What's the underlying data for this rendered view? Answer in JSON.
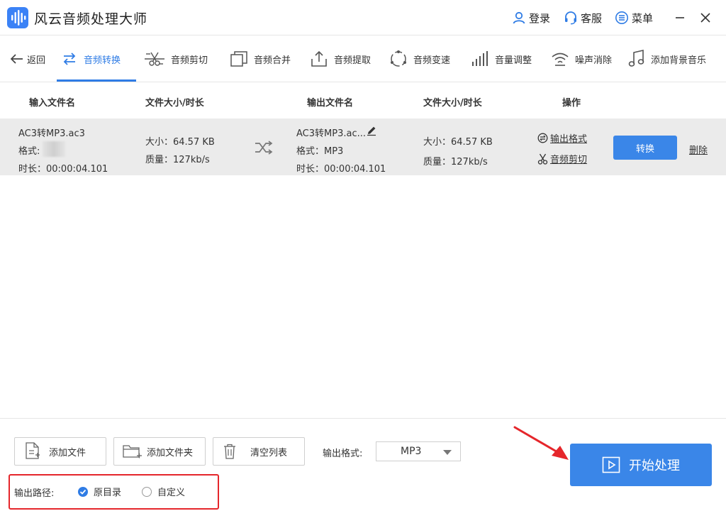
{
  "app": {
    "title": "风云音频处理大师",
    "login": "登录",
    "service": "客服",
    "menu": "菜单"
  },
  "nav": {
    "back": "返回",
    "tabs": [
      "音频转换",
      "音频剪切",
      "音频合并",
      "音频提取",
      "音频变速",
      "音量调整",
      "噪声消除",
      "添加背景音乐"
    ],
    "active_index": 0
  },
  "table": {
    "headers": [
      "输入文件名",
      "文件大小/时长",
      "输出文件名",
      "文件大小/时长",
      "操作"
    ],
    "row": {
      "input_name": "AC3转MP3.ac3",
      "input_format_label": "格式:",
      "input_duration": "时长：00:00:04.101",
      "input_size": "大小：64.57 KB",
      "input_quality": "质量：127kb/s",
      "output_name": "AC3转MP3.ac...",
      "output_format": "格式：MP3",
      "output_duration": "时长：00:00:04.101",
      "output_size": "大小：64.57 KB",
      "output_quality": "质量：127kb/s",
      "op_output_format": "输出格式",
      "op_audio_cut": "音频剪切",
      "convert": "转换",
      "delete": "删除"
    }
  },
  "bottom": {
    "add_file": "添加文件",
    "add_folder": "添加文件夹",
    "clear_list": "清空列表",
    "output_format_label": "输出格式:",
    "output_format_value": "MP3",
    "start": "开始处理",
    "output_path_label": "输出路径:",
    "path_original": "原目录",
    "path_custom": "自定义"
  },
  "colors": {
    "accent": "#2f7ce5",
    "button": "#3a86e8",
    "highlight": "#e5262b"
  }
}
